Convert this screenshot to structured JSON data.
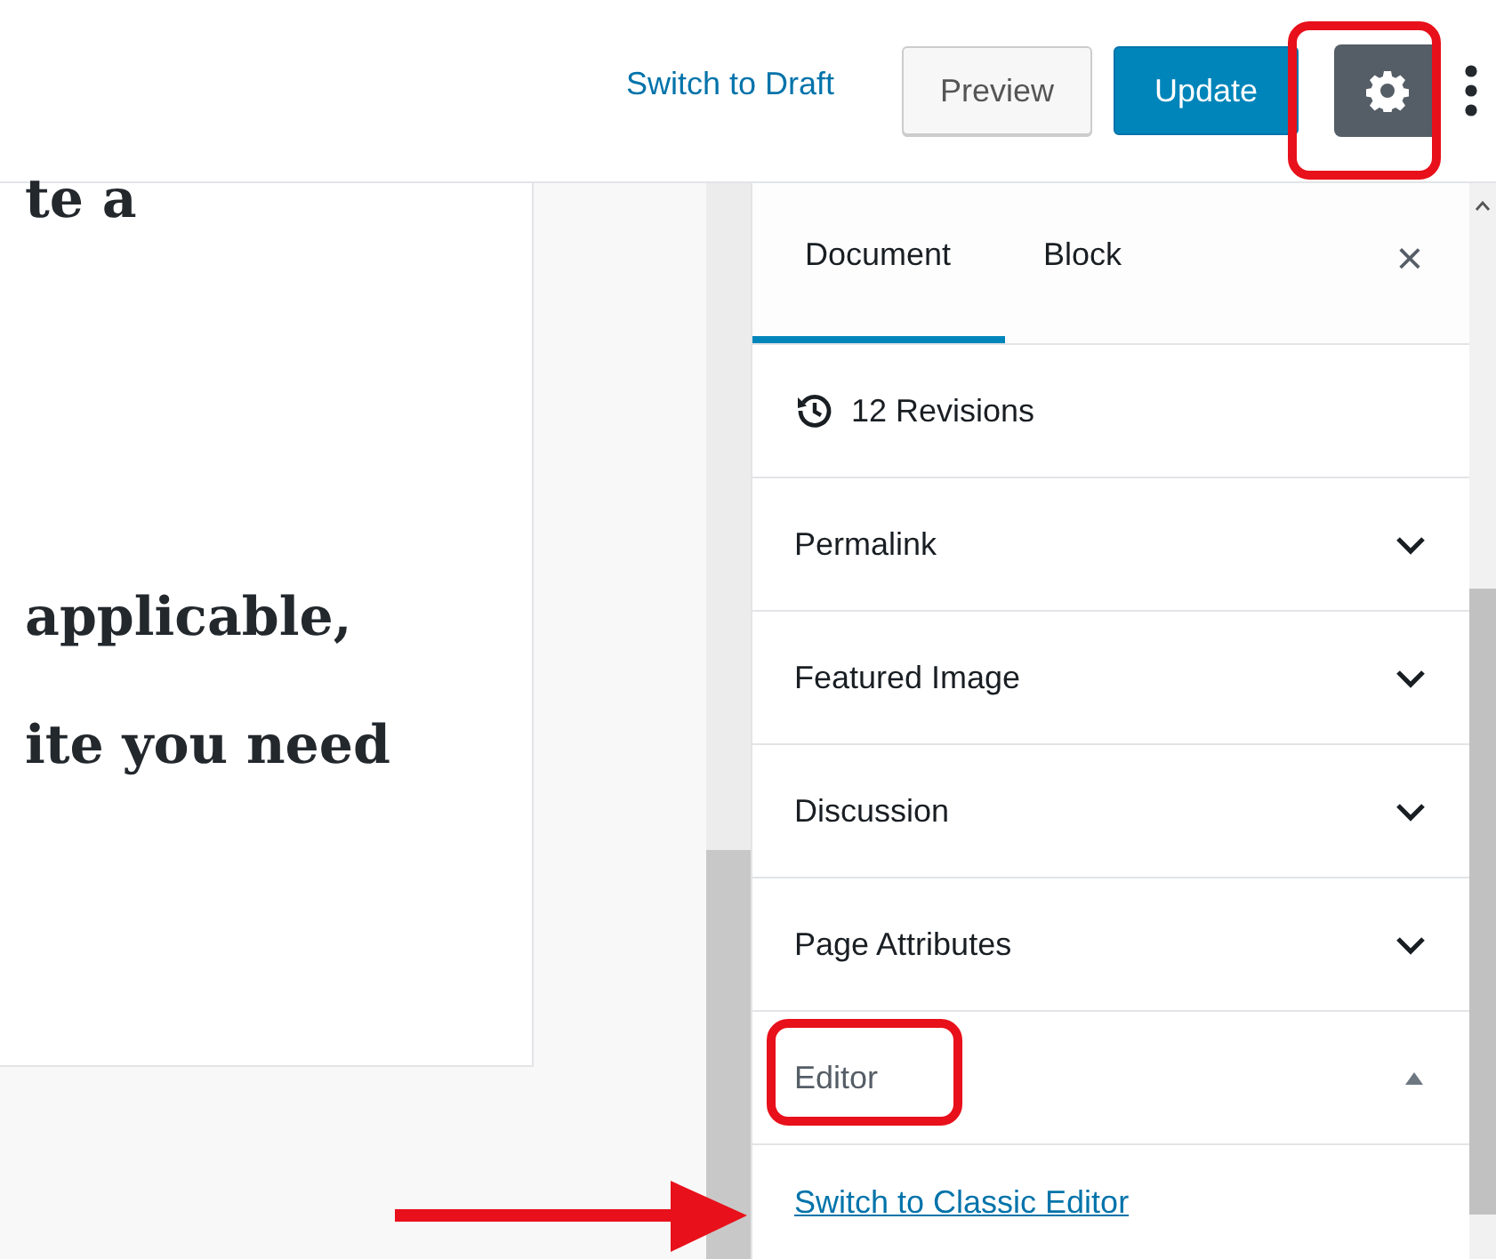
{
  "top_bar": {
    "switch_link": "Switch to Draft",
    "preview_button": "Preview",
    "update_button": "Update",
    "settings_selected": true
  },
  "content": {
    "lines": [
      "te a",
      "applicable,",
      "ite you need"
    ]
  },
  "sidebar": {
    "tabs": [
      {
        "label": "Document",
        "selected": true
      },
      {
        "label": "Block",
        "selected": false
      }
    ],
    "close": "×",
    "revisions": "12 Revisions",
    "panels": [
      {
        "title": "Permalink",
        "expanded": false
      },
      {
        "title": "Featured Image",
        "expanded": false
      },
      {
        "title": "Discussion",
        "expanded": false
      },
      {
        "title": "Page Attributes",
        "expanded": false
      },
      {
        "title": "Editor",
        "expanded": true,
        "link": "Switch to Classic Editor"
      }
    ]
  }
}
